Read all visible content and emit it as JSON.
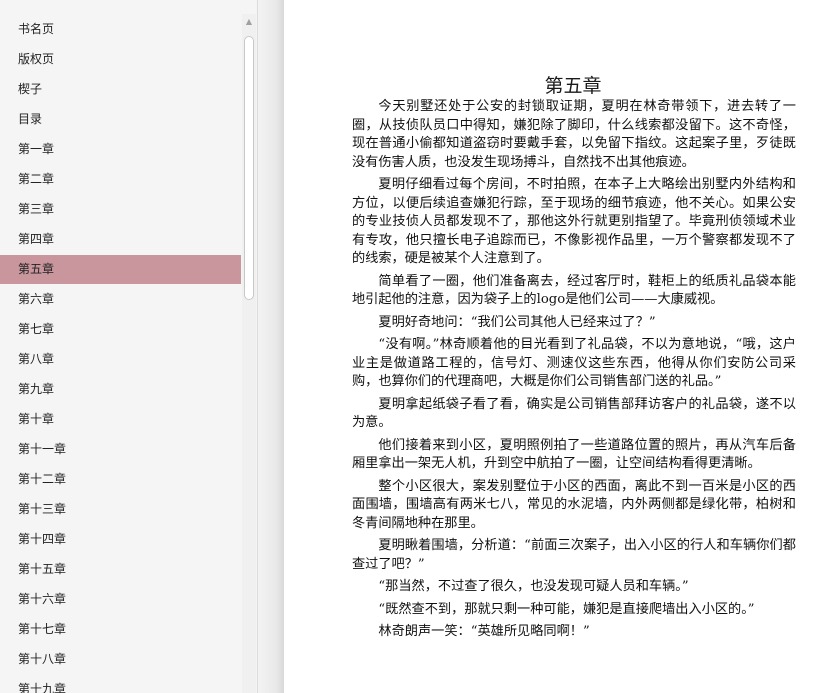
{
  "toc": {
    "items": [
      "书名页",
      "版权页",
      "楔子",
      "目录",
      "第一章",
      "第二章",
      "第三章",
      "第四章",
      "第五章",
      "第六章",
      "第七章",
      "第八章",
      "第九章",
      "第十章",
      "第十一章",
      "第十二章",
      "第十三章",
      "第十四章",
      "第十五章",
      "第十六章",
      "第十七章",
      "第十八章",
      "第十九章"
    ],
    "active": "第五章"
  },
  "colors": {
    "active_item": "#c8969c",
    "sidebar_bg": "#f5f5f5"
  },
  "scroll": {
    "up_icon": "scroll-up-arrow-icon"
  },
  "chapter": {
    "title": "第五章",
    "paragraphs": [
      "今天别墅还处于公安的封锁取证期，夏明在林奇带领下，进去转了一圈，从技侦队员口中得知，嫌犯除了脚印，什么线索都没留下。这不奇怪，现在普通小偷都知道盗窃时要戴手套，以免留下指纹。这起案子里，歹徒既没有伤害人质，也没发生现场搏斗，自然找不出其他痕迹。",
      "夏明仔细看过每个房间，不时拍照，在本子上大略绘出别墅内外结构和方位，以便后续追查嫌犯行踪，至于现场的细节痕迹，他不关心。如果公安的专业技侦人员都发现不了，那他这外行就更别指望了。毕竟刑侦领域术业有专攻，他只擅长电子追踪而已，不像影视作品里，一万个警察都发现不了的线索，硬是被某个人注意到了。",
      "简单看了一圈，他们准备离去，经过客厅时，鞋柜上的纸质礼品袋本能地引起他的注意，因为袋子上的logo是他们公司——大康威视。",
      "夏明好奇地问：“我们公司其他人已经来过了？”",
      "“没有啊。”林奇顺着他的目光看到了礼品袋，不以为意地说，“哦，这户业主是做道路工程的，信号灯、测速仪这些东西，他得从你们安防公司采购，也算你们的代理商吧，大概是你们公司销售部门送的礼品。”",
      "夏明拿起纸袋子看了看，确实是公司销售部拜访客户的礼品袋，遂不以为意。",
      "他们接着来到小区，夏明照例拍了一些道路位置的照片，再从汽车后备厢里拿出一架无人机，升到空中航拍了一圈，让空间结构看得更清晰。",
      "整个小区很大，案发别墅位于小区的西面，离此不到一百米是小区的西面围墙，围墙高有两米七八，常见的水泥墙，内外两侧都是绿化带，柏树和冬青间隔地种在那里。",
      "夏明瞅着围墙，分析道：“前面三次案子，出入小区的行人和车辆你们都查过了吧？”",
      "“那当然，不过查了很久，也没发现可疑人员和车辆。”",
      "“既然查不到，那就只剩一种可能，嫌犯是直接爬墙出入小区的。”",
      "林奇朗声一笑：“英雄所见略同啊！”"
    ]
  }
}
